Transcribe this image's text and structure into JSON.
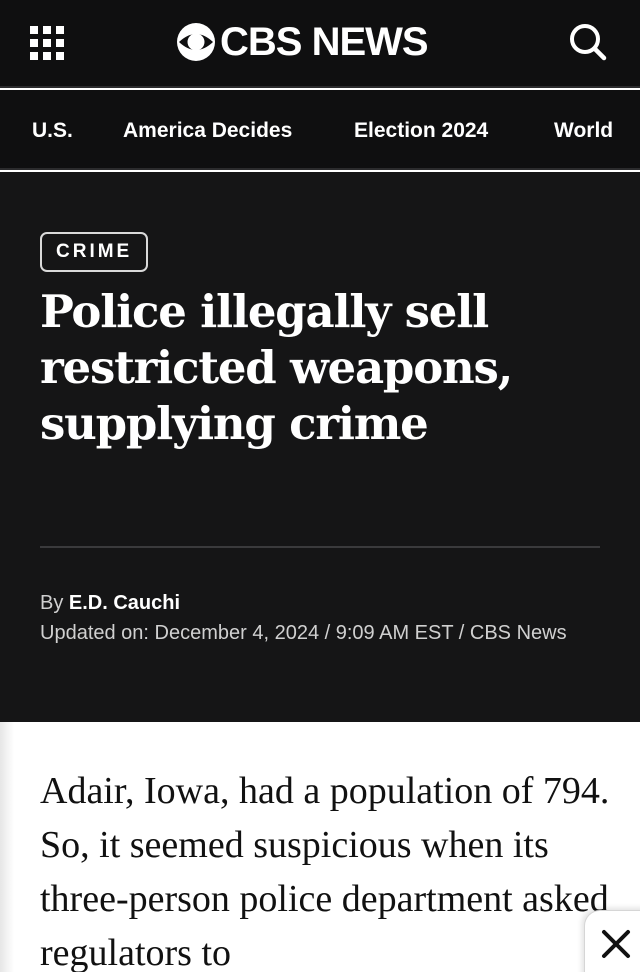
{
  "header": {
    "logo_text": "CBS NEWS",
    "menu_icon": "grid-menu-icon",
    "search_icon": "search-icon",
    "background": "#0f0f10"
  },
  "nav": {
    "items": [
      {
        "label": "U.S."
      },
      {
        "label": "America Decides"
      },
      {
        "label": "Election 2024"
      },
      {
        "label": "World"
      }
    ]
  },
  "article": {
    "category": "CRIME",
    "headline": "Police illegally sell restricted weapons, supplying crime",
    "byline_prefix": "By",
    "author": "E.D. Cauchi",
    "updated": "Updated on: December 4, 2024 / 9:09 AM EST / CBS News",
    "body": "Adair, Iowa, had a population of 794. So, it seemed suspicious when its three-person police department asked regulators to"
  },
  "overlay": {
    "close_icon": "close-icon"
  }
}
